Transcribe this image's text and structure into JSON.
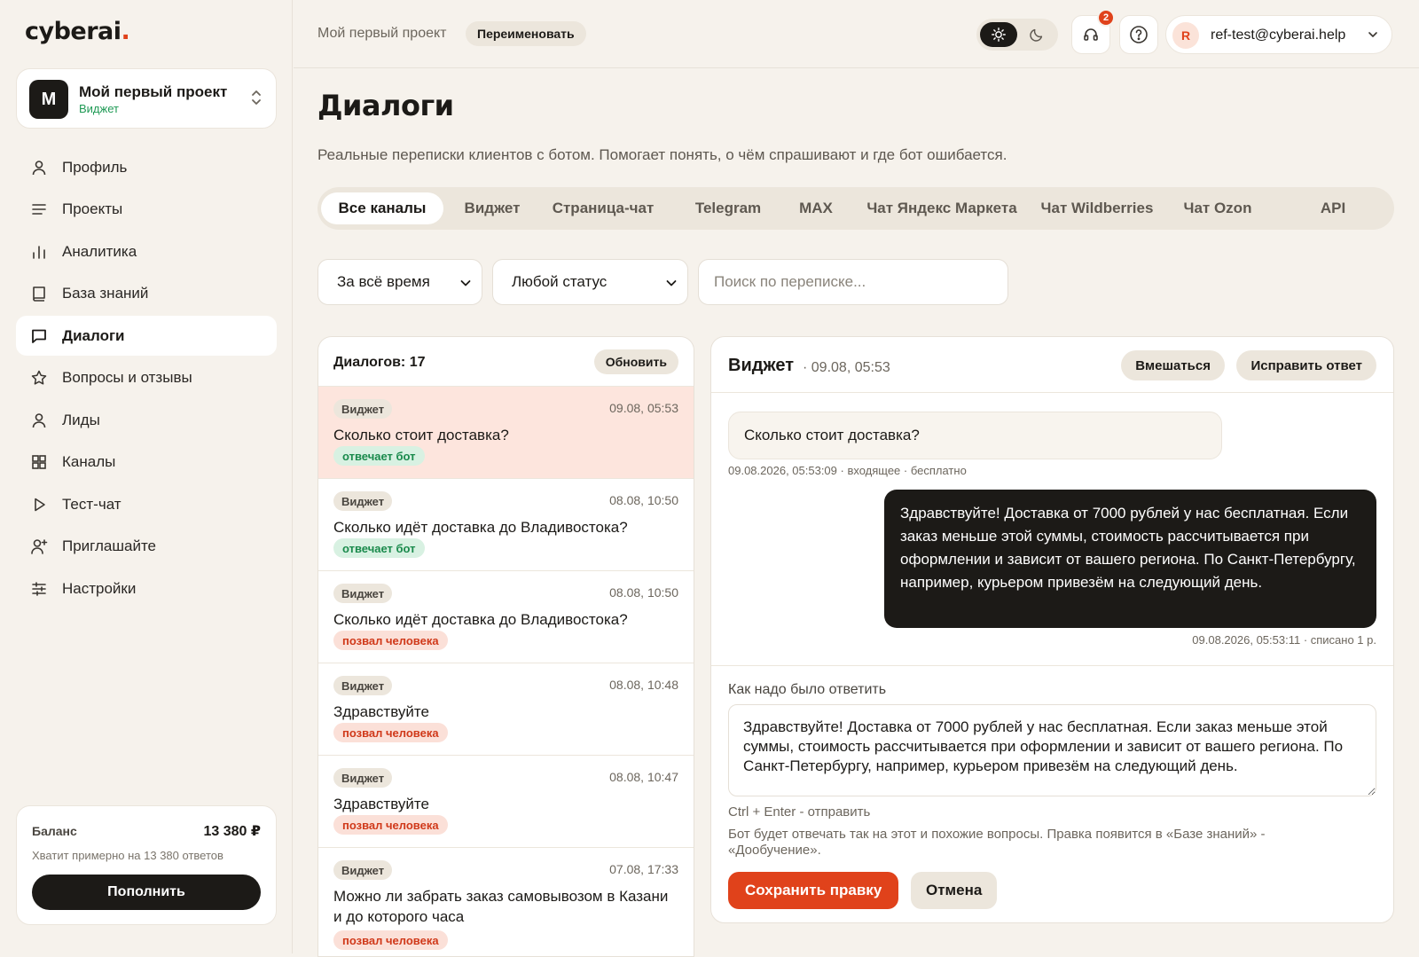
{
  "brand": {
    "name": "cyberai",
    "dot": "."
  },
  "project": {
    "avatar": "M",
    "name": "Мой первый проект",
    "type": "Виджет"
  },
  "nav": [
    {
      "label": "Профиль",
      "icon": "user-icon"
    },
    {
      "label": "Проекты",
      "icon": "list-icon"
    },
    {
      "label": "Аналитика",
      "icon": "bar-chart-icon"
    },
    {
      "label": "База знаний",
      "icon": "book-icon"
    },
    {
      "label": "Диалоги",
      "icon": "chat-icon",
      "active": true
    },
    {
      "label": "Вопросы и отзывы",
      "icon": "star-icon"
    },
    {
      "label": "Лиды",
      "icon": "person-icon"
    },
    {
      "label": "Каналы",
      "icon": "grid-icon"
    },
    {
      "label": "Тест-чат",
      "icon": "play-icon"
    },
    {
      "label": "Приглашайте",
      "icon": "user-plus-icon"
    },
    {
      "label": "Настройки",
      "icon": "sliders-icon"
    }
  ],
  "balance": {
    "title": "Баланс",
    "amount": "13 380 ₽",
    "note": "Хватит примерно на 13 380 ответов",
    "topup_label": "Пополнить"
  },
  "topbar": {
    "project_name": "Мой первый проект",
    "rename_label": "Переименовать",
    "notifications_count": "2",
    "user_initial": "R",
    "user_email": "ref-test@cyberai.help"
  },
  "page": {
    "title": "Диалоги",
    "subtitle": "Реальные переписки клиентов с ботом. Помогает понять, о чём спрашивают и где бот ошибается."
  },
  "tabs": [
    {
      "label": "Все каналы",
      "active": true
    },
    {
      "label": "Виджет"
    },
    {
      "label": "Страница-чат"
    },
    {
      "label": "Telegram"
    },
    {
      "label": "MAX"
    },
    {
      "label": "Чат Яндекс Маркета"
    },
    {
      "label": "Чат Wildberries"
    },
    {
      "label": "Чат Ozon"
    },
    {
      "label": "API"
    }
  ],
  "filters": {
    "period": "За всё время",
    "status": "Любой статус",
    "search_placeholder": "Поиск по переписке..."
  },
  "list": {
    "count_label": "Диалогов: 17",
    "refresh_label": "Обновить",
    "rows": [
      {
        "channel": "Виджет",
        "time": "09.08, 05:53",
        "question": "Сколько стоит доставка?",
        "status": "отвечает бот",
        "status_kind": "bot",
        "selected": true
      },
      {
        "channel": "Виджет",
        "time": "08.08, 10:50",
        "question": "Сколько идёт доставка до Владивостока?",
        "status": "отвечает бот",
        "status_kind": "bot"
      },
      {
        "channel": "Виджет",
        "time": "08.08, 10:50",
        "question": "Сколько идёт доставка до Владивостока?",
        "status": "позвал человека",
        "status_kind": "human"
      },
      {
        "channel": "Виджет",
        "time": "08.08, 10:48",
        "question": "Здравствуйте",
        "status": "позвал человека",
        "status_kind": "human"
      },
      {
        "channel": "Виджет",
        "time": "08.08, 10:47",
        "question": "Здравствуйте",
        "status": "позвал человека",
        "status_kind": "human"
      },
      {
        "channel": "Виджет",
        "time": "07.08, 17:33",
        "question": "Можно ли забрать заказ самовывозом в Казани и до которого часа",
        "status": "позвал человека",
        "status_kind": "human"
      }
    ]
  },
  "detail": {
    "channel": "Виджет",
    "time": "· 09.08, 05:53",
    "intervene_label": "Вмешаться",
    "fix_label": "Исправить ответ",
    "incoming_text": "Сколько стоит доставка?",
    "incoming_meta": "09.08.2026, 05:53:09 · входящее · бесплатно",
    "outgoing_text": "Здравствуйте! Доставка от 7000 рублей у нас бесплатная. Если заказ меньше этой суммы, стоимость рассчитывается при оформлении и зависит от вашего региона. По Санкт-Петербургу, например, курьером привезём на следующий день.",
    "outgoing_meta": "09.08.2026, 05:53:11 · списано 1 р.",
    "correction_label": "Как надо было ответить",
    "correction_value": "Здравствуйте! Доставка от 7000 рублей у нас бесплатная. Если заказ меньше этой суммы, стоимость рассчитывается при оформлении и зависит от вашего региона. По Санкт-Петербургу, например, курьером привезём на следующий день.",
    "shortcut_hint": "Ctrl + Enter - отправить",
    "correction_note": "Бот будет отвечать так на этот и похожие вопросы. Правка появится в «Базе знаний» - «Дообучение».",
    "save_label": "Сохранить правку",
    "cancel_label": "Отмена"
  },
  "colors": {
    "background": "#f6f2ec",
    "accent": "#e0421b",
    "dark": "#1c1a17",
    "success": "#1a8a4c",
    "selected_row": "#fde5dd"
  }
}
